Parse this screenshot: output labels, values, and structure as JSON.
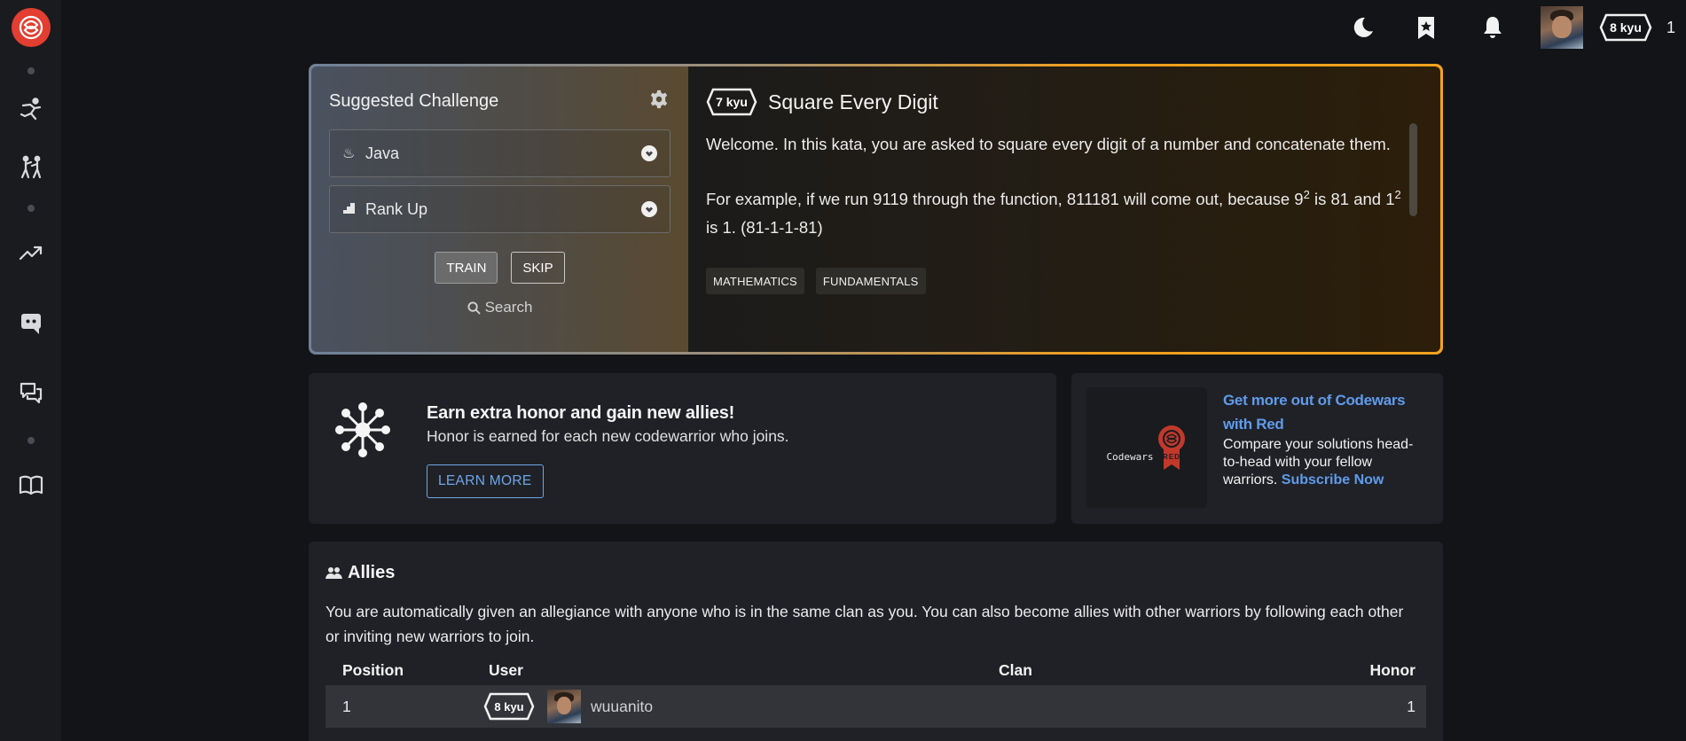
{
  "header": {
    "user_rank": "8 kyu",
    "honor": "1",
    "icons": [
      "moon-icon",
      "bookmark-star-icon",
      "bell-icon"
    ]
  },
  "sidebar": {
    "items": [
      "kata-practice-icon",
      "sparring-icon",
      "leaderboard-icon",
      "discord-icon",
      "discussion-icon",
      "docs-icon"
    ]
  },
  "challenge": {
    "title": "Suggested Challenge",
    "language": "Java",
    "strategy": "Rank Up",
    "train_label": "TRAIN",
    "skip_label": "SKIP",
    "search_label": "Search",
    "kata_rank": "7 kyu",
    "kata_name": "Square Every Digit",
    "desc_p1": "Welcome. In this kata, you are asked to square every digit of a number and concatenate them.",
    "desc_p2_a": "For example, if we run 9119 through the function, 811181 will come out, because 9",
    "sup1": "2",
    "desc_p2_b": " is 81 and 1",
    "sup2": "2",
    "desc_p2_c": " is 1. (81-1-1-81)",
    "tags": [
      "MATHEMATICS",
      "FUNDAMENTALS"
    ]
  },
  "referral": {
    "title": "Earn extra honor and gain new allies!",
    "subtitle": "Honor is earned for each new codewarrior who joins.",
    "button": "LEARN MORE"
  },
  "red": {
    "brand": "Codewars",
    "badge": "RED",
    "title": "Get more out of Codewars with Red",
    "text": "Compare your solutions head-to-head with your fellow warriors.",
    "link": "Subscribe Now"
  },
  "allies": {
    "title": "Allies",
    "description": "You are automatically given an allegiance with anyone who is in the same clan as you. You can also become allies with other warriors by following each other or inviting new warriors to join.",
    "columns": {
      "position": "Position",
      "user": "User",
      "clan": "Clan",
      "honor": "Honor"
    },
    "rows": [
      {
        "position": "1",
        "rank": "8 kyu",
        "user": "wuuanito",
        "clan": "",
        "honor": "1"
      }
    ]
  },
  "colors": {
    "accent_orange": "#f5a31d",
    "link_blue": "#5e9cec",
    "logo_red": "#e23e31"
  }
}
